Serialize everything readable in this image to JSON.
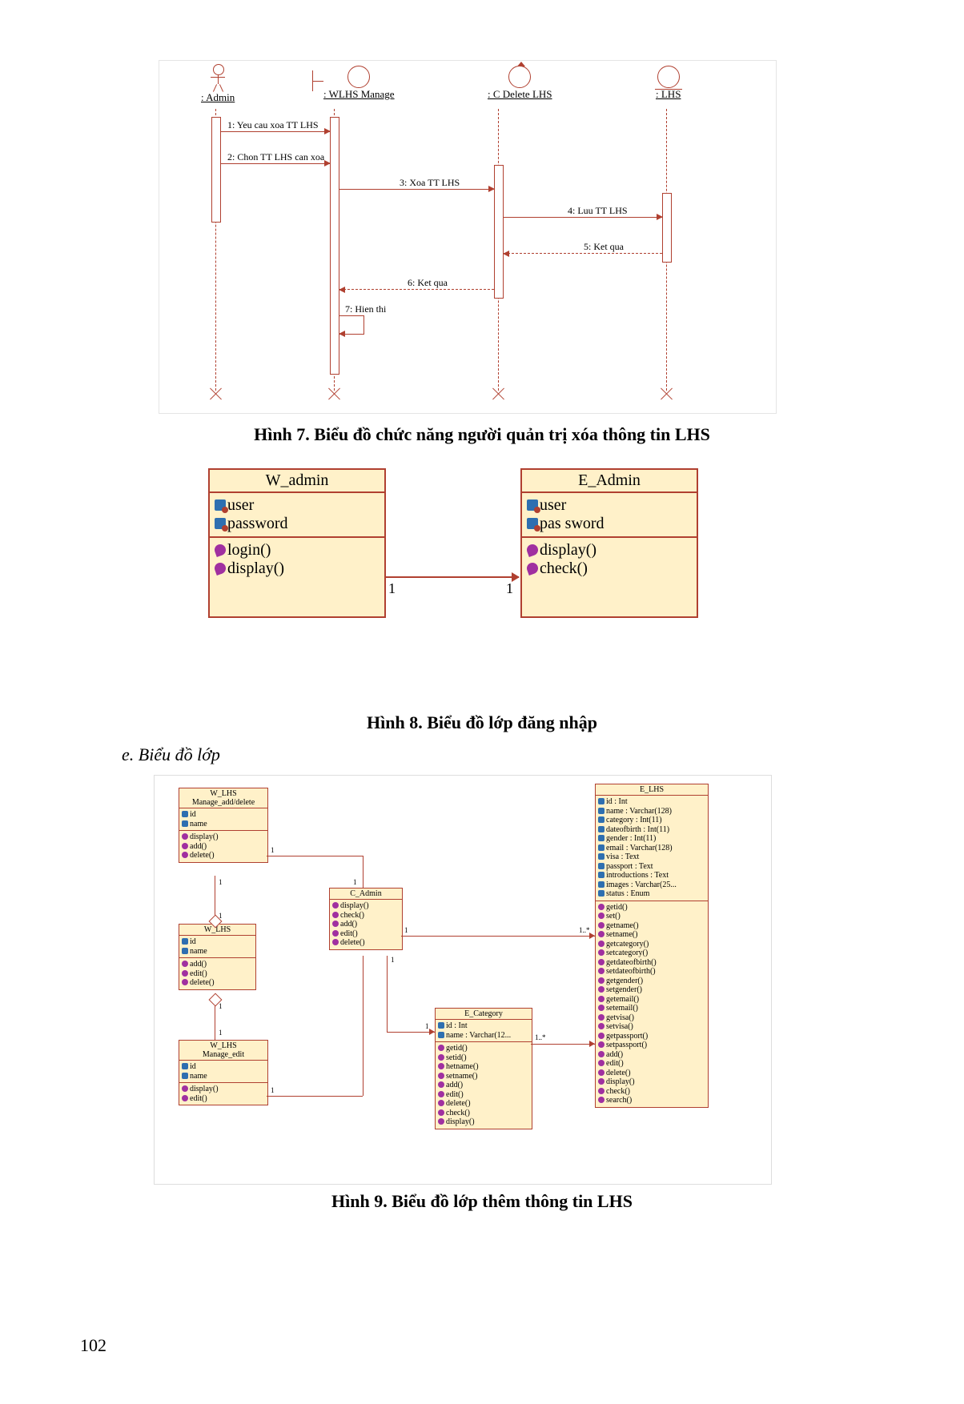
{
  "page_number": "102",
  "captions": {
    "fig7": "Hình 7. Biểu đồ chức năng người quản trị xóa thông tin LHS",
    "fig8": "Hình 8. Biểu đồ lớp đăng nhập",
    "fig9": "Hình 9. Biểu đồ lớp thêm thông tin LHS"
  },
  "section_e": "e. Biểu đồ lớp",
  "fig7": {
    "participants": {
      "admin": ": Admin",
      "wlhs": ": WLHS Manage",
      "cdel": ": C Delete LHS",
      "lhs": ": LHS"
    },
    "messages": {
      "m1": "1: Yeu cau xoa TT LHS",
      "m2": "2: Chon TT LHS can xoa",
      "m3": "3: Xoa TT LHS",
      "m4": "4: Luu TT LHS",
      "m5": "5: Ket qua",
      "m6": "6: Ket qua",
      "m7": "7: Hien thi"
    }
  },
  "fig8": {
    "left": {
      "name": "W_admin",
      "attrs": [
        "user",
        "password"
      ],
      "ops": [
        "login()",
        "display()"
      ]
    },
    "right": {
      "name": "E_Admin",
      "attrs": [
        "user",
        "pas sword"
      ],
      "ops": [
        "display()",
        "check()"
      ]
    },
    "mult_left": "1",
    "mult_right": "1"
  },
  "fig9": {
    "w_add": {
      "title1": "W_LHS",
      "title2": "Manage_add/delete",
      "attrs": [
        "id",
        "name"
      ],
      "ops": [
        "display()",
        "add()",
        "delete()"
      ]
    },
    "w_mid": {
      "title": "W_LHS",
      "attrs": [
        "id",
        "name"
      ],
      "ops": [
        "add()",
        "edit()",
        "delete()"
      ]
    },
    "w_edit": {
      "title1": "W_LHS",
      "title2": "Manage_edit",
      "attrs": [
        "id",
        "name"
      ],
      "ops": [
        "display()",
        "edit()"
      ]
    },
    "c_admin": {
      "title": "C_Admin",
      "ops": [
        "display()",
        "check()",
        "add()",
        "edit()",
        "delete()"
      ]
    },
    "e_cat": {
      "title": "E_Category",
      "attrs": [
        "id : Int",
        "name : Varchar(12..."
      ],
      "ops": [
        "getid()",
        "setid()",
        "hetname()",
        "setname()",
        "add()",
        "edit()",
        "delete()",
        "check()",
        "display()"
      ]
    },
    "e_lhs": {
      "title": "E_LHS",
      "attrs": [
        "id : Int",
        "name : Varchar(128)",
        "category : Int(11)",
        "dateofbirth : Int(11)",
        "gender : Int(11)",
        "email : Varchar(128)",
        "visa : Text",
        "passport : Text",
        "introductions : Text",
        "images : Varchar(25...",
        "status : Enum"
      ],
      "ops": [
        "getid()",
        "set()",
        "getname()",
        "setname()",
        "getcategory()",
        "setcategory()",
        "getdateofbirth()",
        "setdateofbirth()",
        "getgender()",
        "setgender()",
        "getemail()",
        "setemail()",
        "getvisa()",
        "setvisa()",
        "getpassport()",
        "setpassport()",
        "add()",
        "edit()",
        "delete()",
        "display()",
        "check()",
        "search()"
      ]
    },
    "mult": {
      "one": "1",
      "star": "1..*"
    }
  }
}
